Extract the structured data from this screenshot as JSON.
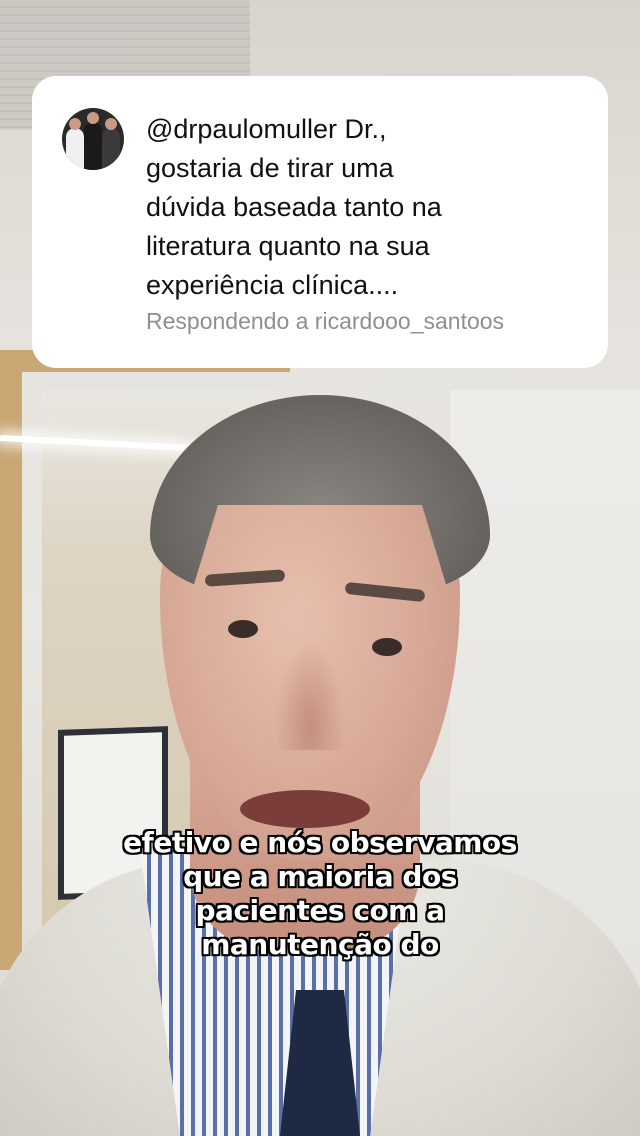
{
  "reply_card": {
    "avatar_icon": "profile-avatar",
    "message": "@drpaulomuller Dr., gostaria de tirar uma dúvida baseada tanto na literatura quanto na sua experiência clínica....",
    "message_lines": [
      "@drpaulomuller Dr.,",
      "gostaria de tirar uma",
      "dúvida baseada tanto na",
      "literatura quanto na sua",
      "experiência clínica...."
    ],
    "replying_to": "Respondendo a ricardooo_santoos"
  },
  "captions": {
    "lines": [
      "efetivo e nós observamos",
      "que a maioria dos",
      "pacientes com a",
      "manutenção do"
    ]
  },
  "colors": {
    "card_bg": "#ffffff",
    "text": "#111111",
    "muted": "#8e8e93",
    "caption_fill": "#ffffff",
    "caption_stroke": "#000000"
  }
}
